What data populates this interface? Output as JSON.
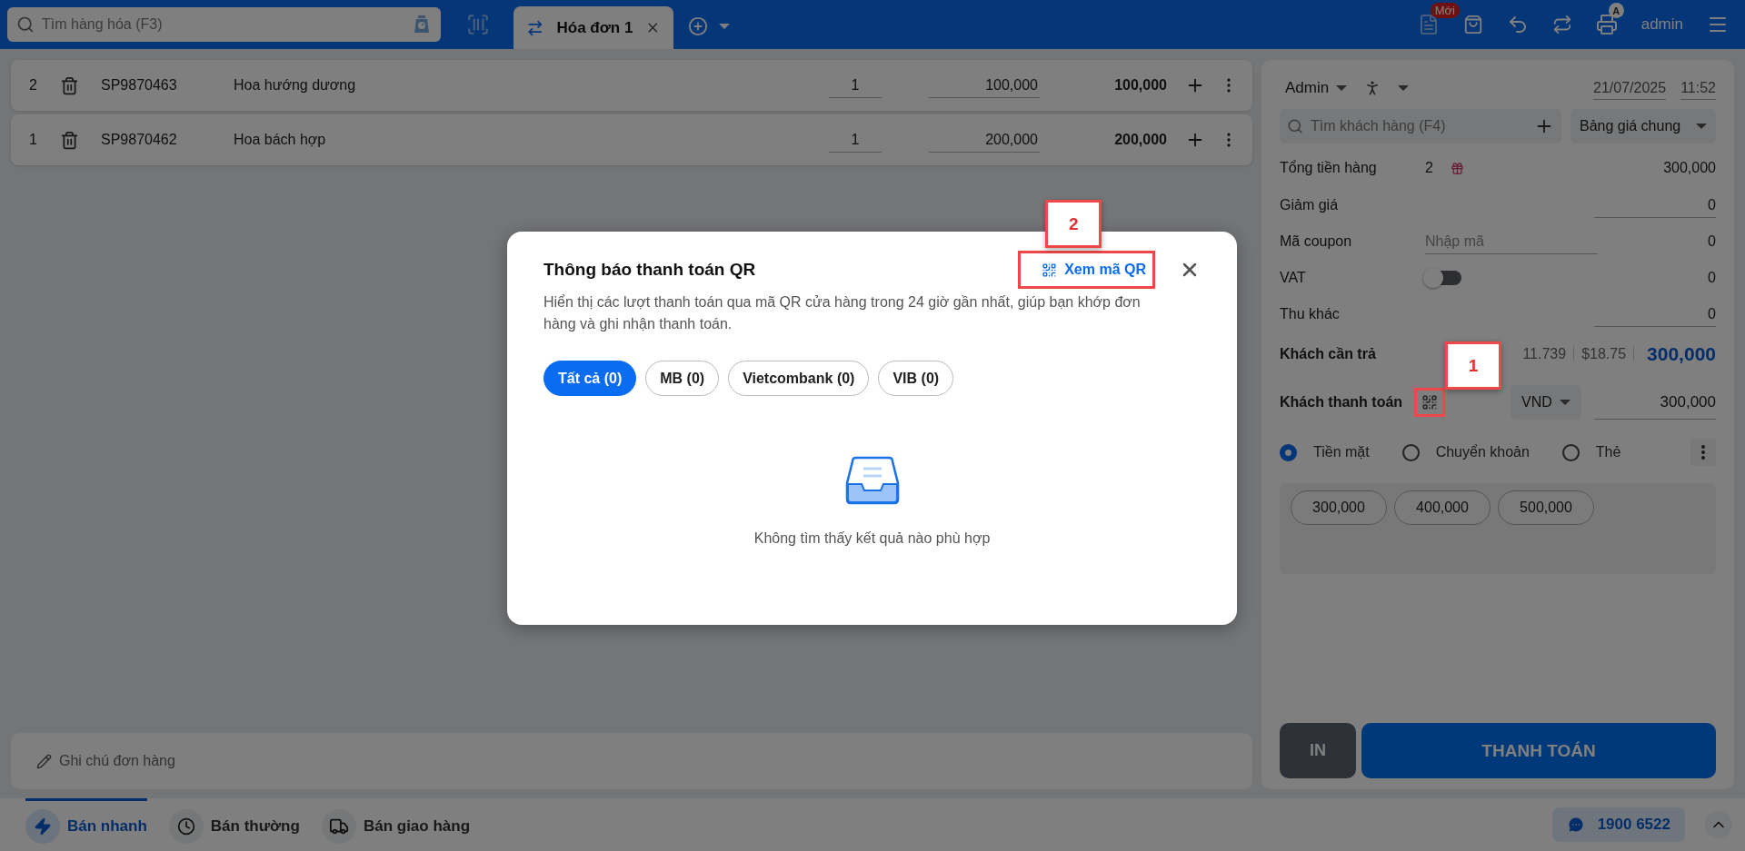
{
  "header": {
    "search_placeholder": "Tìm hàng hóa (F3)",
    "tabs": [
      {
        "label": "Hóa đơn 1",
        "selected": true
      }
    ],
    "new_badge": "Mới",
    "printer_badge": "A",
    "user": "admin"
  },
  "order_lines": [
    {
      "index": "2",
      "code": "SP9870463",
      "name": "Hoa hướng dương",
      "quantity": "1",
      "price": "100,000",
      "total": "100,000"
    },
    {
      "index": "1",
      "code": "SP9870462",
      "name": "Hoa bách hợp",
      "quantity": "1",
      "price": "200,000",
      "total": "200,000"
    }
  ],
  "note": {
    "placeholder": "Ghi chú đơn hàng"
  },
  "checkout": {
    "staff": "Admin",
    "date": "21/07/2025",
    "time": "11:52",
    "customer_placeholder": "Tìm khách hàng (F4)",
    "price_list": "Bảng giá chung",
    "summary": [
      {
        "kind": "count",
        "label": "Tổng tiền hàng",
        "count": "2",
        "value": "300,000"
      },
      {
        "kind": "field",
        "label": "Giảm giá",
        "value": "0"
      },
      {
        "kind": "coupon",
        "label": "Mã coupon",
        "placeholder": "Nhập mã",
        "value": "0"
      },
      {
        "kind": "toggle",
        "label": "VAT",
        "on": false,
        "value": "0"
      },
      {
        "kind": "field",
        "label": "Thu khác",
        "value": "0"
      }
    ],
    "due": {
      "label": "Khách cần trả",
      "rates": [
        "11.739",
        "$18.75"
      ],
      "value": "300,000"
    },
    "paid": {
      "label": "Khách thanh toán",
      "currency": "VND",
      "value": "300,000"
    },
    "methods": [
      {
        "label": "Tiền mặt",
        "selected": true
      },
      {
        "label": "Chuyển khoản",
        "selected": false
      },
      {
        "label": "Thẻ",
        "selected": false
      }
    ],
    "quick_amounts": [
      "300,000",
      "400,000",
      "500,000"
    ],
    "print_button": "IN",
    "pay_button": "THANH TOÁN"
  },
  "bottom_bar": {
    "modes": [
      {
        "kind": "fast",
        "label": "Bán nhanh",
        "selected": true
      },
      {
        "kind": "normal",
        "label": "Bán thường",
        "selected": false
      },
      {
        "kind": "delivery",
        "label": "Bán giao hàng",
        "selected": false
      }
    ],
    "hotline": "1900 6522"
  },
  "modal": {
    "title": "Thông báo thanh toán QR",
    "qr_link": "Xem mã QR",
    "description": "Hiển thị các lượt thanh toán qua mã QR cửa hàng trong 24 giờ gần nhất, giúp bạn khớp đơn hàng và ghi nhận thanh toán.",
    "filters": [
      {
        "label": "Tất cả (0)",
        "selected": true
      },
      {
        "label": "MB (0)",
        "selected": false
      },
      {
        "label": "Vietcombank (0)",
        "selected": false
      },
      {
        "label": "VIB (0)",
        "selected": false
      }
    ],
    "empty_text": "Không tìm thấy kết quả nào phù hợp"
  },
  "annotations": [
    {
      "label": "1"
    },
    {
      "label": "2"
    }
  ]
}
